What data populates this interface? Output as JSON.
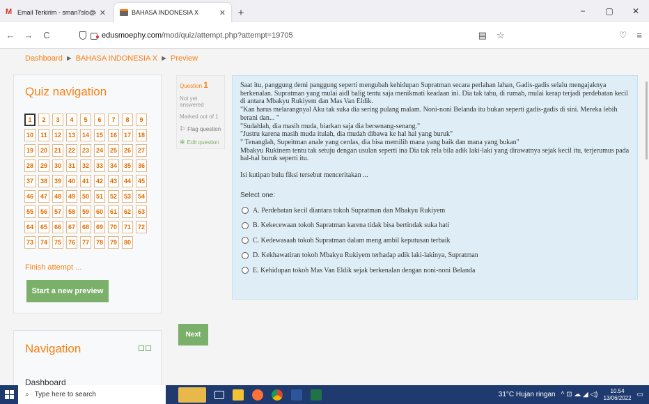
{
  "browser": {
    "tabs": [
      {
        "title": "Email Terkirim - sman7slo@gm",
        "icon": "gmail-icon",
        "active": false
      },
      {
        "title": "BAHASA INDONESIA X",
        "icon": "moodle-icon",
        "active": true
      }
    ],
    "new_tab": "+",
    "window_controls": [
      "−",
      "▢",
      "✕"
    ],
    "nav": {
      "back": "←",
      "forward": "→",
      "reload": "C"
    },
    "url": {
      "host": "edusmoephy.com",
      "path": "/mod/quiz/attempt.php?attempt=19705"
    },
    "right_icons": [
      "▤",
      "☆",
      "♡",
      "≡"
    ]
  },
  "breadcrumb": [
    "Dashboard",
    "BAHASA INDONESIA X",
    "Preview"
  ],
  "breadcrumb_sep": "►",
  "quiz_nav": {
    "title": "Quiz navigation",
    "questions": [
      "1",
      "2",
      "3",
      "4",
      "5",
      "6",
      "7",
      "8",
      "9",
      "10",
      "11",
      "12",
      "13",
      "14",
      "15",
      "16",
      "17",
      "18",
      "19",
      "20",
      "21",
      "22",
      "23",
      "24",
      "25",
      "26",
      "27",
      "28",
      "29",
      "30",
      "31",
      "32",
      "33",
      "34",
      "35",
      "36",
      "37",
      "38",
      "39",
      "40",
      "41",
      "42",
      "43",
      "44",
      "45",
      "46",
      "47",
      "48",
      "49",
      "50",
      "51",
      "52",
      "53",
      "54",
      "55",
      "56",
      "57",
      "58",
      "59",
      "60",
      "61",
      "62",
      "63",
      "64",
      "65",
      "66",
      "67",
      "68",
      "69",
      "70",
      "71",
      "72",
      "73",
      "74",
      "75",
      "76",
      "77",
      "78",
      "79",
      "80"
    ],
    "current": "1",
    "finish_link": "Finish attempt ...",
    "start_button": "Start a new preview"
  },
  "navigation_block": {
    "title": "Navigation",
    "first_item": "Dashboard"
  },
  "question_info": {
    "label": "Question",
    "number": "1",
    "state": "Not yet answered",
    "marks": "Marked out of 1",
    "flag": "Flag question",
    "edit": "Edit question"
  },
  "question": {
    "passage": [
      "Saat itu, panggung demi panggung seperti mengubah kehidupan Supratman secara perlahan lahan, Gadis-gadis selalu mengajaknya berkenalan. Supratman yang mulai aidl balig tentu saja menikmati keadaan ini. Dia tak tahu, di rumah, mulai kerap terjadi perdebatan kecil di antara Mbakyu Rukiyem dan Mas Van Eldik.",
      "\"Kan harus melarangnyal Aku tak suka dia sering pulang malam. Noni-noni Belanda itu bukan seperti gadis-gadis di sini. Mereka lebih berani dan... \"",
      "\"Sudahlah, dia masih muda, biarkan saja dia bersenang-senang.\"",
      "\"Justru karena masih muda itulah, dia mudah dibawa ke hal hal yang buruk\"",
      "\" Tenanglah, Supeitman anale yang cerdas, dia bisa memilih mana yang baik dan mana yang bukan\"",
      "Mbakyu Rukinem tentu tak setuju dengan usulan seperti ina Dia tak rela bila adik laki-laki yang dirawatnya sejak kecil itu, terjerumus pada hal-hal buruk seperti itu."
    ],
    "prompt": "Isi kutipan bulu fiksi tersebut menceritakan ...",
    "select_one": "Select one:",
    "options": [
      "A. Perdebatan kecil diantara tokoh Supratman dan Mbakyu Rukiyem",
      "B. Kekecewaan tokoh Sapratman karena tidak bisa bertindak suka hati",
      "C. Kedewasaah tokoh Supratman dalam meng ambil keputusan terbaik",
      "D. Kekhawatiran tokoh Mbakyu Rukiyem terhadap adik laki-lakinya, Supratman",
      "E. Kehidupan tokoh Mas Van Eldik sejak berkenalan dengan noni-noni Belanda"
    ],
    "next_button": "Next"
  },
  "taskbar": {
    "search_placeholder": "Type here to search",
    "weather": "31°C  Hujan ringan",
    "time": "10.54",
    "date": "13/06/2022"
  },
  "colors": {
    "accent": "#f98012",
    "green": "#7ab06a",
    "question_bg": "#dfeef6",
    "taskbar": "#1e3a6e"
  }
}
